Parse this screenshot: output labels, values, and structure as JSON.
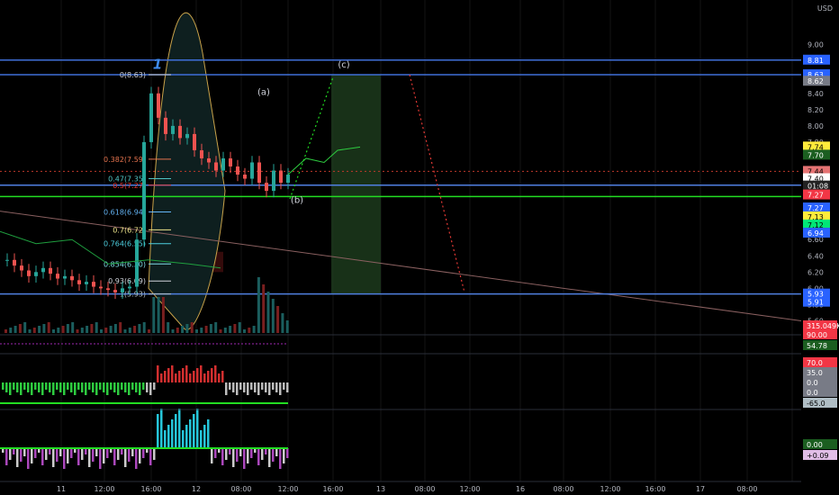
{
  "currency": "USD",
  "chart_data": {
    "type": "line",
    "title": "",
    "xlabel": "",
    "ylabel": "",
    "ylim": [
      5.45,
      9.55
    ],
    "x_ticks": [
      "11",
      "12:00",
      "16:00",
      "12",
      "08:00",
      "12:00",
      "16:00",
      "13",
      "08:00",
      "12:00",
      "16",
      "08:00",
      "12:00",
      "16:00",
      "17",
      "08:00"
    ],
    "y_ticks": [
      "9.00",
      "8.80",
      "8.40",
      "8.20",
      "8.00",
      "7.80",
      "6.60",
      "6.40",
      "6.20",
      "6.00",
      "5.80",
      "5.60"
    ],
    "fib_levels": [
      {
        "label": "0(8.63)",
        "value": 8.63,
        "color": "#d1d4dc"
      },
      {
        "label": "0.382(7.59)",
        "value": 7.59,
        "color": "#e5734e"
      },
      {
        "label": "0.47(7.35)",
        "value": 7.35,
        "color": "#4fc3c3"
      },
      {
        "label": "0.5(7.27)",
        "value": 7.27,
        "color": "#e53935"
      },
      {
        "label": "0.618(6.94)",
        "value": 6.94,
        "color": "#64b5f6"
      },
      {
        "label": "0.7(6.72)",
        "value": 6.72,
        "color": "#f0e68c"
      },
      {
        "label": "0.764(6.55)",
        "value": 6.55,
        "color": "#4dd0e1"
      },
      {
        "label": "0.854(6.30)",
        "value": 6.3,
        "color": "#80deea"
      },
      {
        "label": "0.93(6.09)",
        "value": 6.09,
        "color": "#d1d4dc"
      },
      {
        "label": "1(5.93)",
        "value": 5.93,
        "color": "#b0bec5"
      }
    ],
    "horizontal_lines": [
      {
        "value": 8.81,
        "color": "#3f6fd8"
      },
      {
        "value": 8.63,
        "color": "#3f6fd8"
      },
      {
        "value": 7.27,
        "color": "#4f7fe0"
      },
      {
        "value": 7.13,
        "color": "#22dd22"
      },
      {
        "value": 5.93,
        "color": "#4f7fe0"
      }
    ],
    "wave_labels": [
      {
        "text": "1",
        "x": 175,
        "value": 8.7,
        "color": "#3f8cf0"
      },
      {
        "text": "(a)",
        "x": 293,
        "value": 8.38,
        "color": "#d1d4dc"
      },
      {
        "text": "(b)",
        "x": 330,
        "value": 7.05,
        "color": "#d1d4dc"
      },
      {
        "text": "(c)",
        "x": 382,
        "value": 8.72,
        "color": "#d1d4dc"
      }
    ],
    "price_tags": [
      {
        "text": "9.00",
        "value": 9.0,
        "bg": "#000000",
        "fg": "#b2b5be"
      },
      {
        "text": "8.81",
        "value": 8.81,
        "bg": "#2962ff",
        "fg": "#ffffff"
      },
      {
        "text": "8.63",
        "value": 8.63,
        "bg": "#2962ff",
        "fg": "#ffffff"
      },
      {
        "text": "8.62",
        "value": 8.55,
        "bg": "#787b86",
        "fg": "#ffffff"
      },
      {
        "text": "7.74",
        "value": 7.74,
        "bg": "#ffeb3b",
        "fg": "#000000"
      },
      {
        "text": "7.70",
        "value": 7.64,
        "bg": "#1b5e20",
        "fg": "#ffffff"
      },
      {
        "text": "7.44",
        "value": 7.44,
        "bg": "#e57373",
        "fg": "#000000"
      },
      {
        "text": "7.40",
        "value": 7.35,
        "bg": "#ffffff",
        "fg": "#000000"
      },
      {
        "text": "01:08",
        "value": 7.26,
        "bg": "#222222",
        "fg": "#ffffff"
      },
      {
        "text": "7.27",
        "value": 7.15,
        "bg": "#f23645",
        "fg": "#ffffff"
      },
      {
        "text": "7.27",
        "value": 6.99,
        "bg": "#2962ff",
        "fg": "#ffffff"
      },
      {
        "text": "7.13",
        "value": 6.88,
        "bg": "#ffeb3b",
        "fg": "#000000"
      },
      {
        "text": "7.12",
        "value": 6.78,
        "bg": "#00e676",
        "fg": "#000000"
      },
      {
        "text": "6.94",
        "value": 6.68,
        "bg": "#2962ff",
        "fg": "#ffffff"
      },
      {
        "text": "5.93",
        "value": 5.93,
        "bg": "#2962ff",
        "fg": "#ffffff"
      },
      {
        "text": "5.91",
        "value": 5.83,
        "bg": "#2962ff",
        "fg": "#ffffff"
      }
    ],
    "series": [
      {
        "values": [
          6.35,
          6.28,
          6.22,
          6.15,
          6.2,
          6.25,
          6.18,
          6.12,
          6.15,
          6.1,
          6.05,
          6.08,
          6.02,
          6.0,
          5.98,
          5.95,
          6.0,
          6.02,
          6.6,
          7.8,
          8.4,
          8.1,
          7.9,
          8.0,
          7.85,
          7.9,
          7.7,
          7.6,
          7.55,
          7.45,
          7.6,
          7.5,
          7.4,
          7.35,
          7.55,
          7.3,
          7.2,
          7.45,
          7.3,
          7.4
        ]
      }
    ]
  },
  "indicators": {
    "volume": {
      "label": "315.049K",
      "color": "#f23645"
    },
    "rsi": {
      "labels": [
        "90.00",
        "54.78"
      ],
      "colors": [
        "#f23645",
        "#1b5e20"
      ]
    },
    "oscillator": {
      "labels": [
        "70.0",
        "35.0",
        "0.0",
        "0.0",
        "-65.0"
      ],
      "colors": [
        "#f23645",
        "#787b86",
        "#787b86",
        "#787b86",
        "#b0bec5"
      ]
    },
    "macd": {
      "labels": [
        "0.00",
        "+0.09"
      ],
      "colors": [
        "#1b5e20",
        "#e1bee7"
      ]
    }
  }
}
